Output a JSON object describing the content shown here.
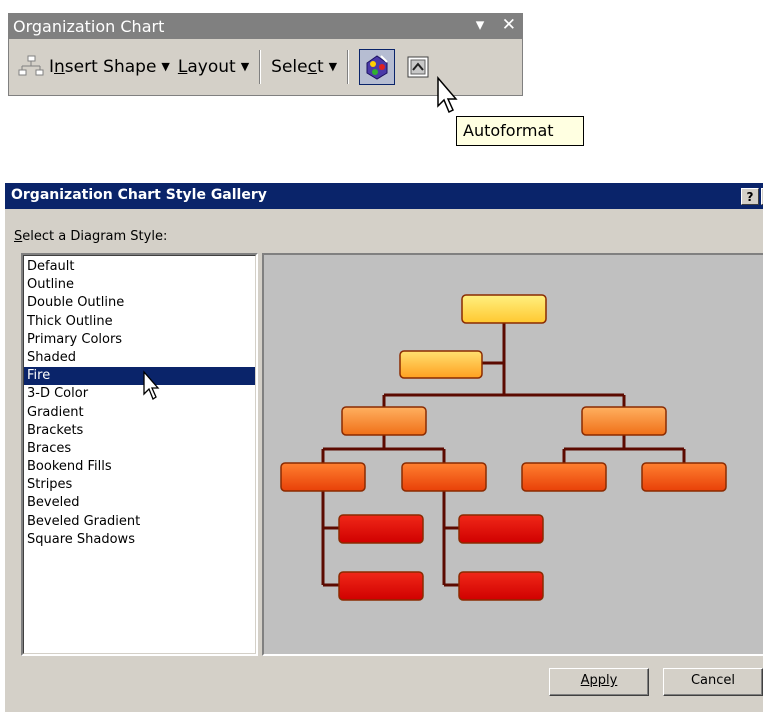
{
  "toolbar": {
    "title": "Organization Chart",
    "menu_glyph": "▾",
    "close_glyph": "✕",
    "insert_shape_prefix": "I",
    "insert_shape_accel": "n",
    "insert_shape_rest": "sert Shape",
    "layout_accel": "L",
    "layout_rest": "ayout",
    "select_prefix": "Sele",
    "select_accel": "c",
    "select_rest": "t",
    "tooltip": "Autoformat"
  },
  "dialog": {
    "title": "Organization Chart Style Gallery",
    "help_glyph": "?",
    "close_glyph": "✕",
    "label_accel": "S",
    "label_rest": "elect a Diagram Style:",
    "styles": [
      "Default",
      "Outline",
      "Double Outline",
      "Thick Outline",
      "Primary Colors",
      "Shaded",
      "Fire",
      "3-D Color",
      "Gradient",
      "Brackets",
      "Braces",
      "Bookend Fills",
      "Stripes",
      "Beveled",
      "Beveled Gradient",
      "Square Shadows"
    ],
    "selected_style": "Fire",
    "apply_label": "Apply",
    "cancel_label": "Cancel"
  },
  "colors": {
    "title_active": "#0a246a",
    "face": "#d4d0c8",
    "preview_bg": "#c0c0c0",
    "connector": "#5c0a00"
  }
}
